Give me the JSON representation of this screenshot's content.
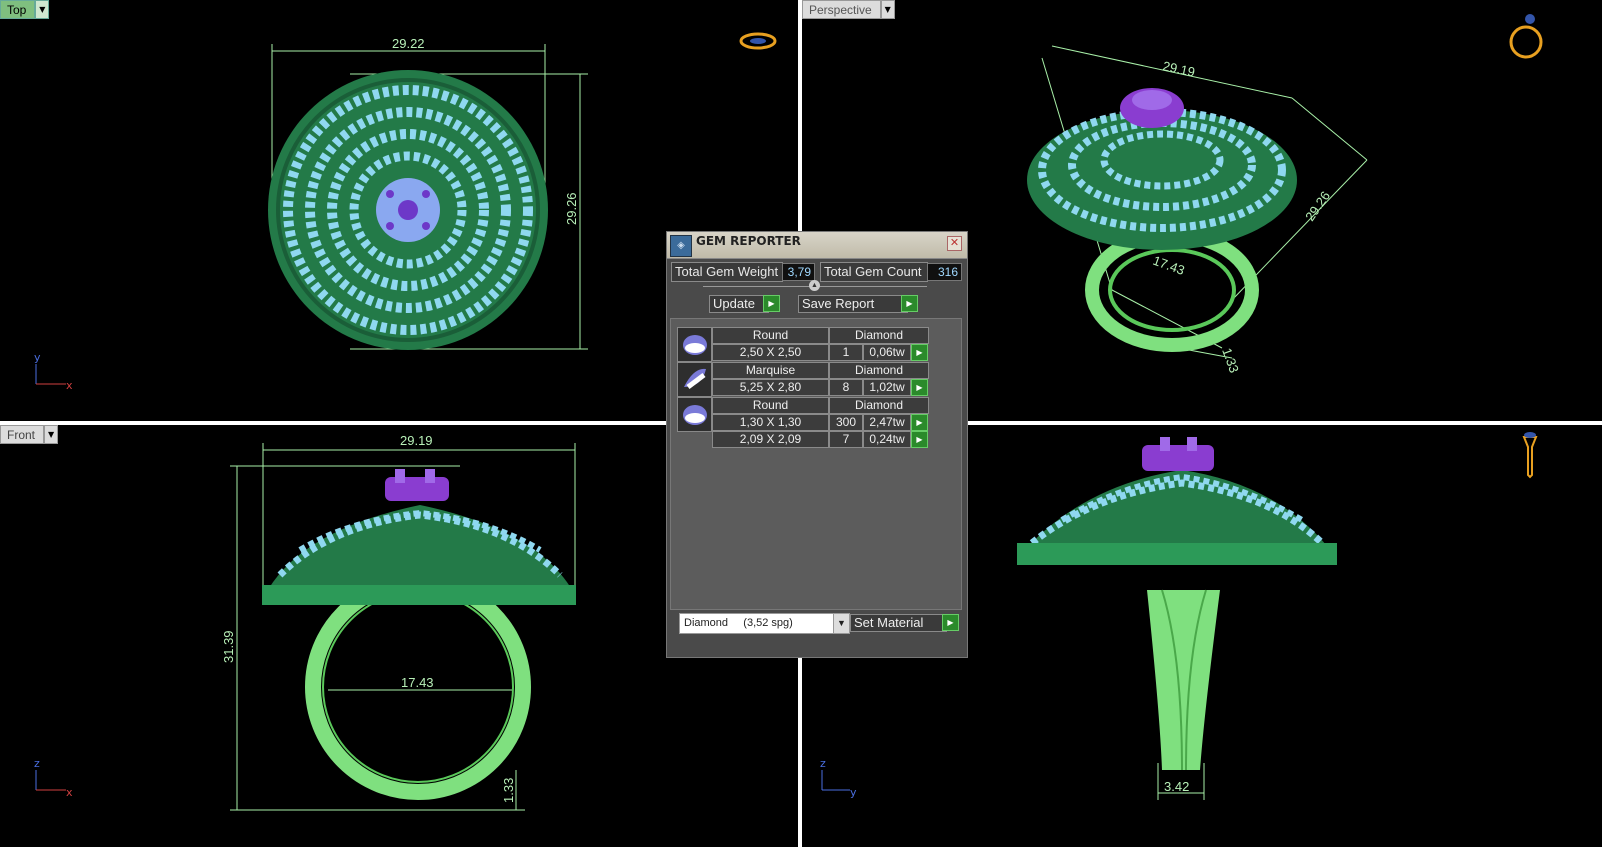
{
  "viewports": {
    "top": {
      "label": "Top",
      "dims": [
        "29.22",
        "29.26"
      ],
      "axes": [
        "y",
        "x"
      ]
    },
    "perspective": {
      "label": "Perspective",
      "dims": [
        "29.19",
        "29.26",
        "17.43",
        "1.33"
      ]
    },
    "front": {
      "label": "Front",
      "dims": [
        "29.19",
        "31.39",
        "17.43",
        "1.33"
      ],
      "axes": [
        "z",
        "x"
      ]
    },
    "right": {
      "dims": [
        "3.42"
      ],
      "axes": [
        "z",
        "y"
      ]
    }
  },
  "gem_reporter": {
    "title": "GEM REPORTER",
    "total_weight_label": "Total Gem Weight",
    "total_weight_value": "3,79",
    "total_count_label": "Total Gem Count",
    "total_count_value": "316",
    "update_label": "Update",
    "save_report_label": "Save Report",
    "groups": [
      {
        "shape": "Round",
        "material": "Diamond",
        "rows": [
          {
            "size": "2,50 X 2,50",
            "count": "1",
            "weight": "0,06tw"
          }
        ]
      },
      {
        "shape": "Marquise",
        "material": "Diamond",
        "rows": [
          {
            "size": "5,25 X 2,80",
            "count": "8",
            "weight": "1,02tw"
          }
        ]
      },
      {
        "shape": "Round",
        "material": "Diamond",
        "rows": [
          {
            "size": "1,30 X 1,30",
            "count": "300",
            "weight": "2,47tw"
          },
          {
            "size": "2,09 X 2,09",
            "count": "7",
            "weight": "0,24tw"
          }
        ]
      }
    ],
    "material_select": "Diamond     (3,52 spg)",
    "set_material_label": "Set Material"
  },
  "colors": {
    "metal": "#2e8a55",
    "gems": "#8fd8f0",
    "center": "#8a3dd0",
    "shank": "#7fe07f",
    "dimension": "#a8f0a8"
  }
}
